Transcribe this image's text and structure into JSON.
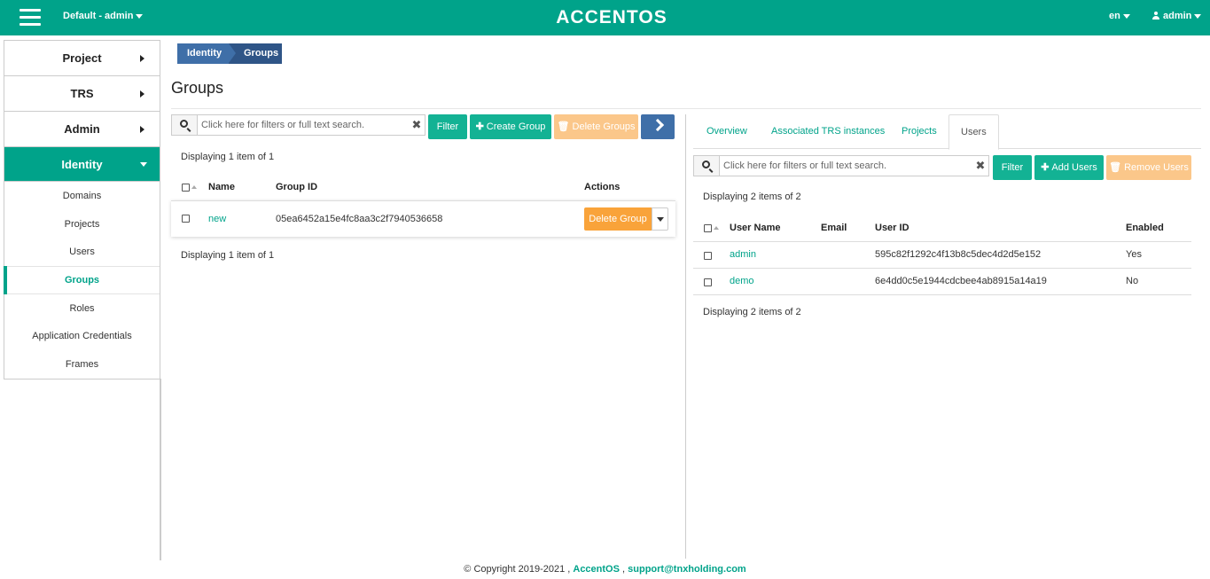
{
  "topbar": {
    "project_switcher": "Default - admin",
    "logo": "ACCENTOS",
    "language": "en",
    "user": "admin"
  },
  "sidebar": {
    "top_items": [
      {
        "label": "Project",
        "icon": "chevron-right-icon"
      },
      {
        "label": "TRS",
        "icon": "chevron-right-icon"
      },
      {
        "label": "Admin",
        "icon": "chevron-right-icon"
      },
      {
        "label": "Identity",
        "icon": "chevron-down-icon",
        "active": true
      }
    ],
    "sub_items": [
      {
        "label": "Domains"
      },
      {
        "label": "Projects"
      },
      {
        "label": "Users"
      },
      {
        "label": "Groups",
        "active": true
      },
      {
        "label": "Roles"
      },
      {
        "label": "Application Credentials"
      },
      {
        "label": "Frames"
      }
    ]
  },
  "breadcrumb": [
    "Identity",
    "Groups"
  ],
  "page_title": "Groups",
  "groups_panel": {
    "search_placeholder": "Click here for filters or full text search.",
    "filter_label": "Filter",
    "create_label": "Create Group",
    "delete_label": "Delete Groups",
    "display_count_top": "Displaying 1 item of 1",
    "display_count_bottom": "Displaying 1 item of 1",
    "columns": [
      "Name",
      "Group ID",
      "Actions"
    ],
    "rows": [
      {
        "name": "new",
        "group_id": "05ea6452a15e4fc8aa3c2f7940536658",
        "action": "Delete Group"
      }
    ]
  },
  "detail_panel": {
    "tabs": [
      "Overview",
      "Associated TRS instances",
      "Projects",
      "Users"
    ],
    "active_tab": "Users",
    "search_placeholder": "Click here for filters or full text search.",
    "filter_label": "Filter",
    "add_label": "Add Users",
    "remove_label": "Remove Users",
    "display_count_top": "Displaying 2 items of 2",
    "display_count_bottom": "Displaying 2 items of 2",
    "columns": [
      "User Name",
      "Email",
      "User ID",
      "Enabled"
    ],
    "rows": [
      {
        "user_name": "admin",
        "email": "",
        "user_id": "595c82f1292c4f13b8c5dec4d2d5e152",
        "enabled": "Yes"
      },
      {
        "user_name": "demo",
        "email": "",
        "user_id": "6e4dd0c5e1944cdcbee4ab8915a14a19",
        "enabled": "No"
      }
    ]
  },
  "footer": {
    "copyright": "© Copyright 2019-2021 ,",
    "brand_link": "AccentOS",
    "separator": ",",
    "support_link": "support@tnxholding.com"
  },
  "colors": {
    "brand": "#00a38a",
    "breadcrumb": "#3f6fa8",
    "warning": "#f9a33a",
    "disabled_warning": "#fbc78a"
  }
}
